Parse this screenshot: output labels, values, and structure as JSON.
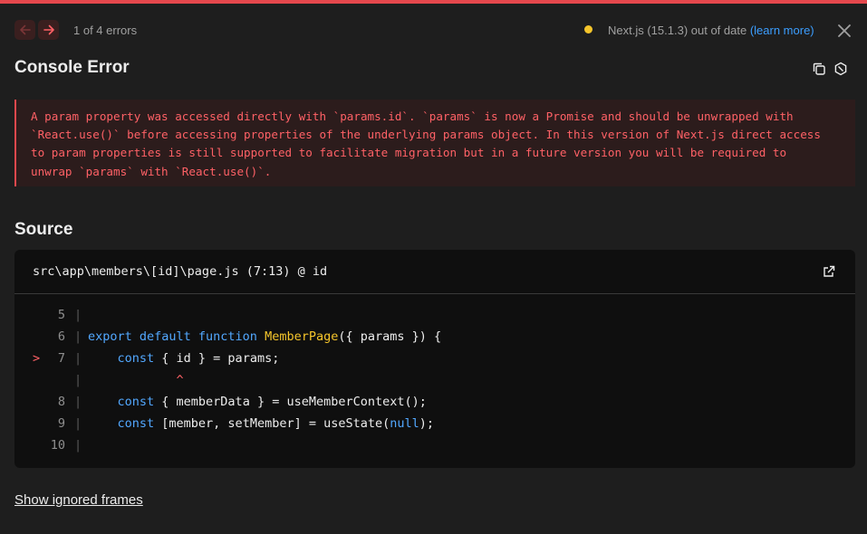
{
  "header": {
    "error_count": "1 of 4 errors",
    "version_text": "Next.js (15.1.3) out of date",
    "learn_more": "(learn more)"
  },
  "error": {
    "title": "Console Error",
    "message_lines": [
      "A param property was accessed directly with `params.id`. `params` is now a Promise and should be unwrapped with",
      "`React.use()` before accessing properties of the underlying params object. In this version of Next.js direct access",
      "to param properties is still supported to facilitate migration but in a future version you will be required to",
      "unwrap `params` with `React.use()`."
    ]
  },
  "source": {
    "heading": "Source",
    "file": "src\\app\\members\\[id]\\page.js (7:13) @ id",
    "lines": [
      {
        "num": "5",
        "marker": "",
        "tokens": []
      },
      {
        "num": "6",
        "marker": "",
        "tokens": [
          {
            "t": "export default function ",
            "c": "kw"
          },
          {
            "t": "MemberPage",
            "c": "fn"
          },
          {
            "t": "({ params }) {",
            "c": ""
          }
        ]
      },
      {
        "num": "7",
        "marker": ">",
        "tokens": [
          {
            "t": "    ",
            "c": ""
          },
          {
            "t": "const",
            "c": "kw"
          },
          {
            "t": " { id } = params;",
            "c": ""
          }
        ]
      },
      {
        "num": "",
        "marker": "",
        "tokens": [
          {
            "t": "            ^",
            "c": "caret"
          }
        ]
      },
      {
        "num": "8",
        "marker": "",
        "tokens": [
          {
            "t": "    ",
            "c": ""
          },
          {
            "t": "const",
            "c": "kw"
          },
          {
            "t": " { memberData } = ",
            "c": ""
          },
          {
            "t": "useMemberContext",
            "c": ""
          },
          {
            "t": "();",
            "c": ""
          }
        ]
      },
      {
        "num": "9",
        "marker": "",
        "tokens": [
          {
            "t": "    ",
            "c": ""
          },
          {
            "t": "const",
            "c": "kw"
          },
          {
            "t": " [member, setMember] = ",
            "c": ""
          },
          {
            "t": "useState",
            "c": ""
          },
          {
            "t": "(",
            "c": ""
          },
          {
            "t": "null",
            "c": "kw"
          },
          {
            "t": ");",
            "c": ""
          }
        ]
      },
      {
        "num": "10",
        "marker": "",
        "tokens": []
      }
    ]
  },
  "footer": {
    "show_ignored": "Show ignored frames"
  },
  "colors": {
    "accent_red": "#e5484d",
    "keyword": "#52a8ff",
    "function": "#f5c52b",
    "link": "#3b9eff",
    "warning_dot": "#f5c52b"
  },
  "icons": [
    "arrow-left-icon",
    "arrow-right-icon",
    "close-icon",
    "copy-icon",
    "nextjs-logo-icon",
    "external-link-icon"
  ]
}
